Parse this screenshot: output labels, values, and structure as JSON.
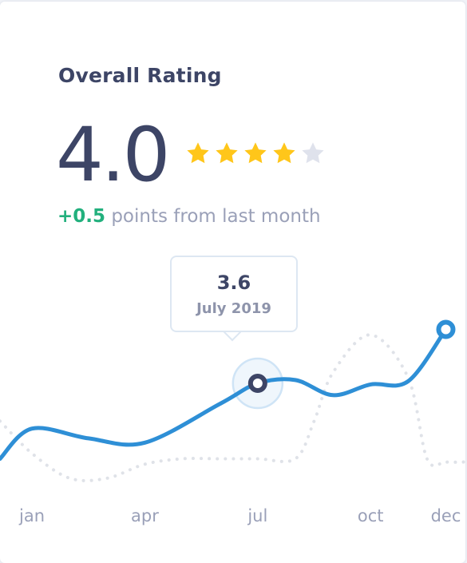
{
  "card": {
    "title": "Overall Rating",
    "score": "4.0",
    "stars": {
      "filled": 4,
      "total": 5
    },
    "delta": {
      "value": "+0.5",
      "text": "points from last month"
    },
    "tooltip": {
      "value": "3.6",
      "date": "July 2019"
    }
  },
  "colors": {
    "star_filled": "#ffc61a",
    "star_empty": "#dfe2ec",
    "current_line": "#2e8fd6",
    "previous_line": "#dfe2e8",
    "positive": "#22b07d",
    "text_dark": "#3d4566"
  },
  "chart_data": {
    "type": "line",
    "categories": [
      "jan",
      "apr",
      "jul",
      "oct",
      "dec"
    ],
    "tick_labels": [
      "jan",
      "apr",
      "jul",
      "oct",
      "dec"
    ],
    "x_domain": [
      -0.85,
      11.52
    ],
    "ylim": [
      2.6,
      4.6
    ],
    "series": [
      {
        "style": "solid",
        "x": [
          -0.85,
          0,
          1.5,
          3,
          5,
          6,
          7,
          8,
          9,
          10,
          11
        ],
        "y": [
          2.9,
          3.18,
          3.09,
          3.05,
          3.41,
          3.6,
          3.63,
          3.49,
          3.59,
          3.62,
          4.1
        ]
      },
      {
        "style": "dotted",
        "x": [
          -0.85,
          0,
          1,
          2,
          3,
          4,
          5,
          6,
          7,
          7.5,
          8,
          9,
          10,
          10.5,
          11,
          11.52
        ],
        "y": [
          3.25,
          2.95,
          2.72,
          2.72,
          2.85,
          2.9,
          2.9,
          2.9,
          2.9,
          3.25,
          3.7,
          4.05,
          3.65,
          2.9,
          2.87,
          2.87
        ]
      }
    ],
    "highlight": {
      "x": 6,
      "y": 3.6
    },
    "endpoint": {
      "x": 11,
      "y": 4.1
    }
  }
}
